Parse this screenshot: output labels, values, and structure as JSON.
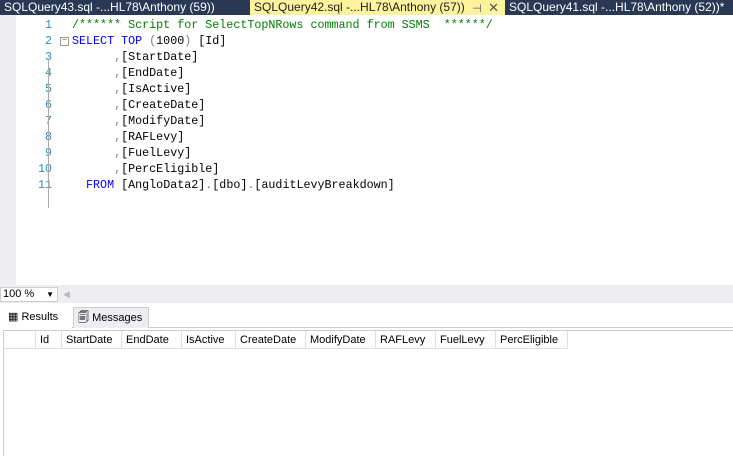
{
  "tabs": [
    {
      "label": "SQLQuery43.sql -...HL78\\Anthony (59))",
      "active": false
    },
    {
      "label": "SQLQuery42.sql -...HL78\\Anthony (57))",
      "active": true
    },
    {
      "label": "SQLQuery41.sql -...HL78\\Anthony (52))*",
      "active": false
    }
  ],
  "tab_icons": {
    "pin": "⊣",
    "close": "✕"
  },
  "editor": {
    "lines": [
      {
        "n": "1",
        "parts": [
          [
            "cm",
            "/****** Script for SelectTopNRows command from SSMS  ******/"
          ]
        ]
      },
      {
        "n": "2",
        "parts": [
          [
            "kw",
            "SELECT TOP "
          ],
          [
            "gr",
            "("
          ],
          [
            "tx",
            "1000"
          ],
          [
            "gr",
            ") "
          ],
          [
            "tx",
            "[Id]"
          ]
        ]
      },
      {
        "n": "3",
        "parts": [
          [
            "tx",
            "      "
          ],
          [
            "gr",
            ","
          ],
          [
            "tx",
            "[StartDate]"
          ]
        ]
      },
      {
        "n": "4",
        "parts": [
          [
            "tx",
            "      "
          ],
          [
            "gr",
            ","
          ],
          [
            "tx",
            "[EndDate]"
          ]
        ]
      },
      {
        "n": "5",
        "parts": [
          [
            "tx",
            "      "
          ],
          [
            "gr",
            ","
          ],
          [
            "tx",
            "[IsActive]"
          ]
        ]
      },
      {
        "n": "6",
        "parts": [
          [
            "tx",
            "      "
          ],
          [
            "gr",
            ","
          ],
          [
            "tx",
            "[CreateDate]"
          ]
        ]
      },
      {
        "n": "7",
        "parts": [
          [
            "tx",
            "      "
          ],
          [
            "gr",
            ","
          ],
          [
            "tx",
            "[ModifyDate]"
          ]
        ]
      },
      {
        "n": "8",
        "parts": [
          [
            "tx",
            "      "
          ],
          [
            "gr",
            ","
          ],
          [
            "tx",
            "[RAFLevy]"
          ]
        ]
      },
      {
        "n": "9",
        "parts": [
          [
            "tx",
            "      "
          ],
          [
            "gr",
            ","
          ],
          [
            "tx",
            "[FuelLevy]"
          ]
        ]
      },
      {
        "n": "10",
        "parts": [
          [
            "tx",
            "      "
          ],
          [
            "gr",
            ","
          ],
          [
            "tx",
            "[PercEligible]"
          ]
        ]
      },
      {
        "n": "11",
        "parts": [
          [
            "tx",
            "  "
          ],
          [
            "kw",
            "FROM "
          ],
          [
            "tx",
            "[AngloData2]"
          ],
          [
            "gr",
            "."
          ],
          [
            "tx",
            "[dbo]"
          ],
          [
            "gr",
            "."
          ],
          [
            "tx",
            "[auditLevyBreakdown]"
          ]
        ]
      }
    ]
  },
  "zoom": {
    "value": "100 %"
  },
  "results_tabs": {
    "results": "Results",
    "messages": "Messages"
  },
  "grid": {
    "columns": [
      "Id",
      "StartDate",
      "EndDate",
      "IsActive",
      "CreateDate",
      "ModifyDate",
      "RAFLevy",
      "FuelLevy",
      "PercEligible"
    ]
  }
}
